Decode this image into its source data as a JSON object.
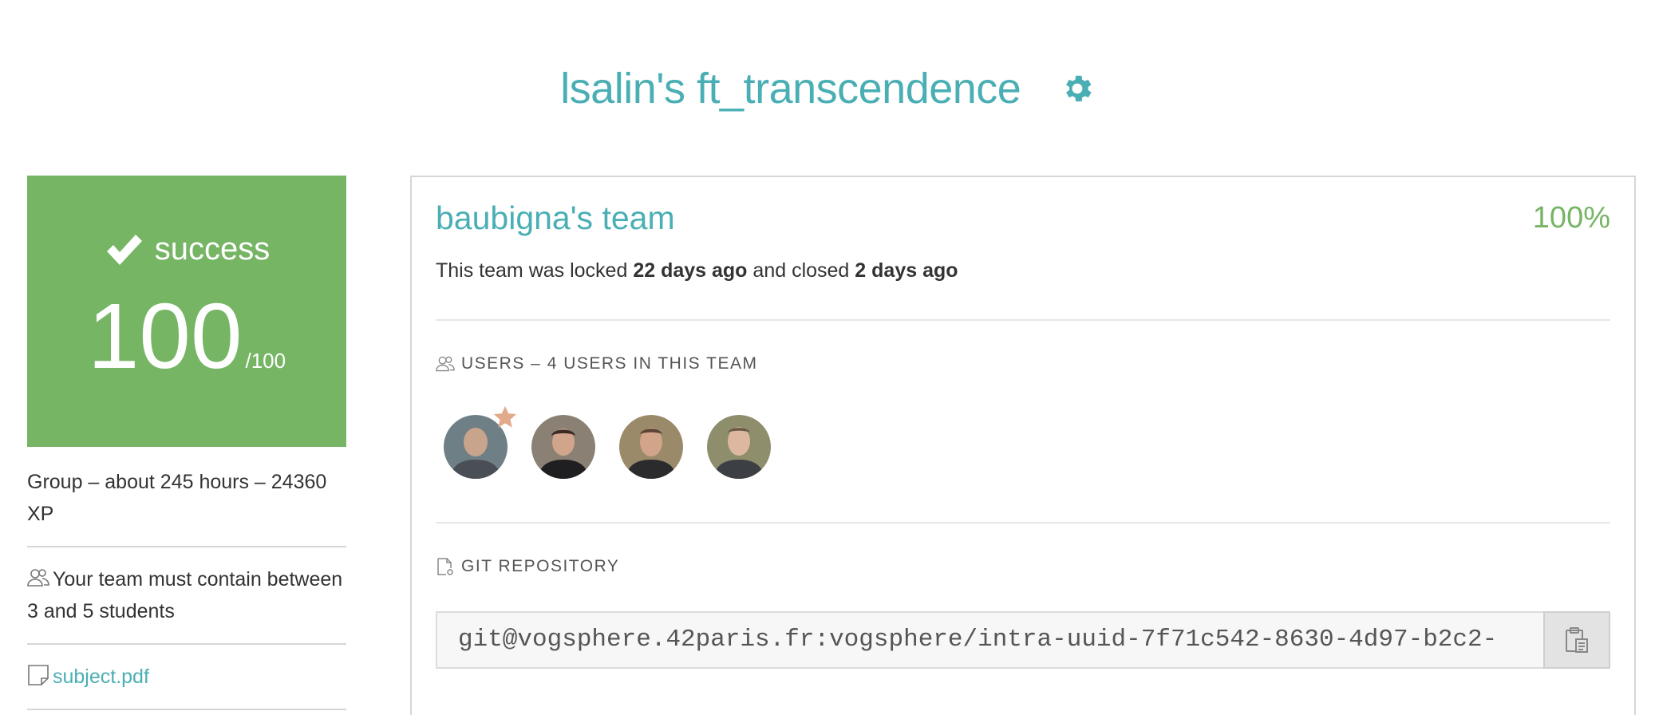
{
  "header": {
    "title": "lsalin's ft_transcendence"
  },
  "status": {
    "label": "success",
    "score": "100",
    "max": "/100"
  },
  "left": {
    "info": "Group – about 245 hours – 24360 XP",
    "team_rule": "Your team must contain between 3 and 5 students",
    "subject_link": "subject.pdf"
  },
  "team": {
    "name": "baubigna's team",
    "percent": "100%",
    "locked_prefix": "This team was locked ",
    "locked_when": "22 days ago",
    "closed_prefix": " and closed ",
    "closed_when": "2 days ago"
  },
  "users": {
    "heading": "USERS – 4 USERS IN THIS TEAM",
    "avatars": [
      {
        "name": "avatar-1",
        "leader": true
      },
      {
        "name": "avatar-2",
        "leader": false
      },
      {
        "name": "avatar-3",
        "leader": false
      },
      {
        "name": "avatar-4",
        "leader": false
      }
    ]
  },
  "repo": {
    "heading": "GIT REPOSITORY",
    "url": "git@vogsphere.42paris.fr:vogsphere/intra-uuid-7f71c542-8630-4d97-b2c2-"
  },
  "colors": {
    "accent": "#4aafb4",
    "success": "#75b564",
    "leader_star": "#e2a98a"
  },
  "icons": [
    "gear-icon",
    "checkmark-icon",
    "users-icon",
    "document-icon",
    "git-file-icon",
    "clipboard-icon",
    "star-icon"
  ]
}
